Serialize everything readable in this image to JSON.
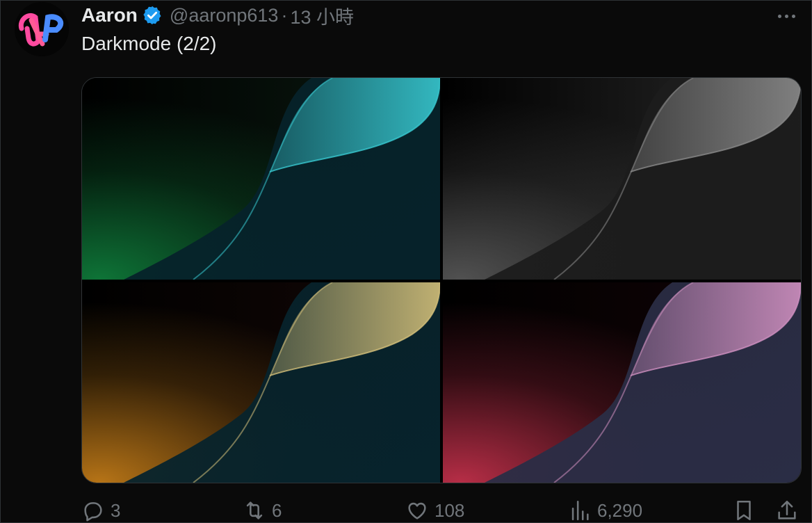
{
  "tweet": {
    "author_name": "Aaron",
    "handle": "@aaronp613",
    "separator": "·",
    "time": "13 小時",
    "text": "Darkmode (2/2)",
    "verified_color": "#1d9bf0",
    "avatar_colors": [
      "#ff3b8d",
      "#3b7bff"
    ]
  },
  "media": {
    "tiles": [
      {
        "name": "green",
        "bg": "#0a1a10",
        "left": "#0f7a3a",
        "right": "#38c8d0",
        "dark": "#06222a"
      },
      {
        "name": "gray",
        "bg": "#2a2a2a",
        "left": "#555555",
        "right": "#8a8a8a",
        "dark": "#1c1c1c"
      },
      {
        "name": "amber",
        "bg": "#140806",
        "left": "#c07a18",
        "right": "#d4c07a",
        "dark": "#07232c"
      },
      {
        "name": "rose",
        "bg": "#120406",
        "left": "#c0304a",
        "right": "#d090c0",
        "dark": "#2a2d45"
      }
    ]
  },
  "actions": {
    "reply": {
      "icon": "reply-icon",
      "count": "3"
    },
    "retweet": {
      "icon": "retweet-icon",
      "count": "6"
    },
    "like": {
      "icon": "heart-icon",
      "count": "108"
    },
    "views": {
      "icon": "views-icon",
      "count": "6,290"
    },
    "bookmark": {
      "icon": "bookmark-icon"
    },
    "share": {
      "icon": "share-icon"
    }
  }
}
